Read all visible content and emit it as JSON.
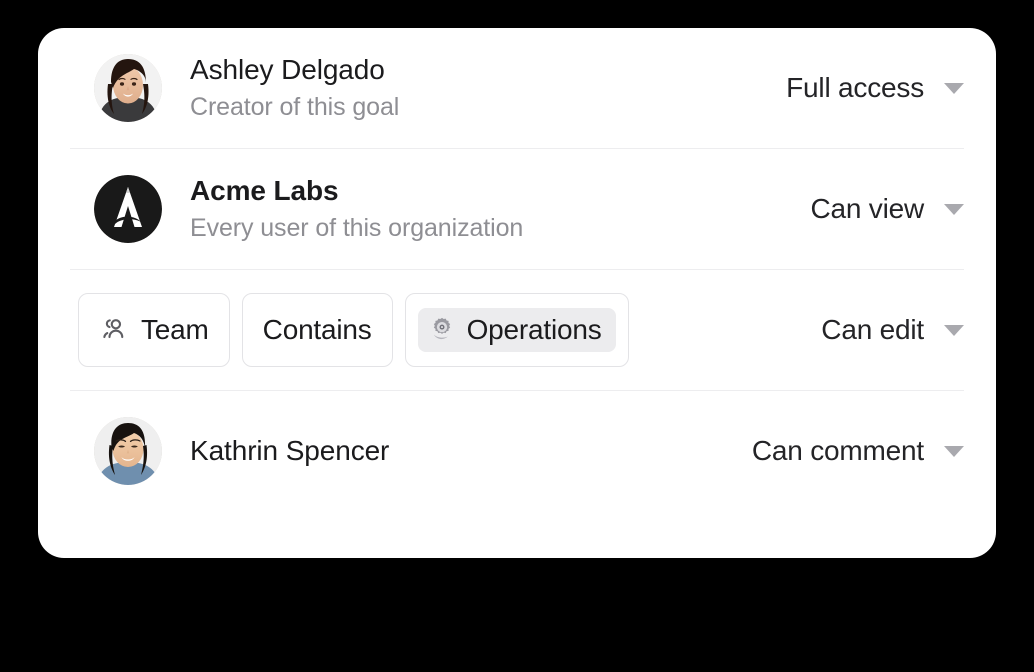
{
  "card": {
    "background_color": "#ffffff",
    "page_background_color": "#000000"
  },
  "rows": [
    {
      "type": "person",
      "avatar_name": "avatar-ashley-delgado",
      "name": "Ashley Delgado",
      "subtitle": "Creator of this goal",
      "permission": "Full access"
    },
    {
      "type": "organization",
      "avatar_name": "avatar-acme-labs-logo",
      "name": "Acme Labs",
      "subtitle": "Every user of this organization",
      "permission": "Can view"
    },
    {
      "type": "rule",
      "chips": [
        {
          "icon": "people-icon",
          "label": "Team",
          "highlighted": false
        },
        {
          "icon": "none",
          "label": "Contains",
          "highlighted": false
        },
        {
          "icon": "gear-icon",
          "label": "Operations",
          "highlighted": true
        }
      ],
      "permission": "Can edit"
    },
    {
      "type": "person",
      "avatar_name": "avatar-kathrin-spencer",
      "name": "Kathrin Spencer",
      "subtitle": "",
      "permission": "Can comment"
    }
  ],
  "colors": {
    "primary_text": "#1b1b1d",
    "secondary_text": "#8e8e93",
    "divider": "#ededef",
    "chip_border": "#e3e3e6",
    "chip_inner_background": "#ececee",
    "caret": "#a9a9ae"
  }
}
